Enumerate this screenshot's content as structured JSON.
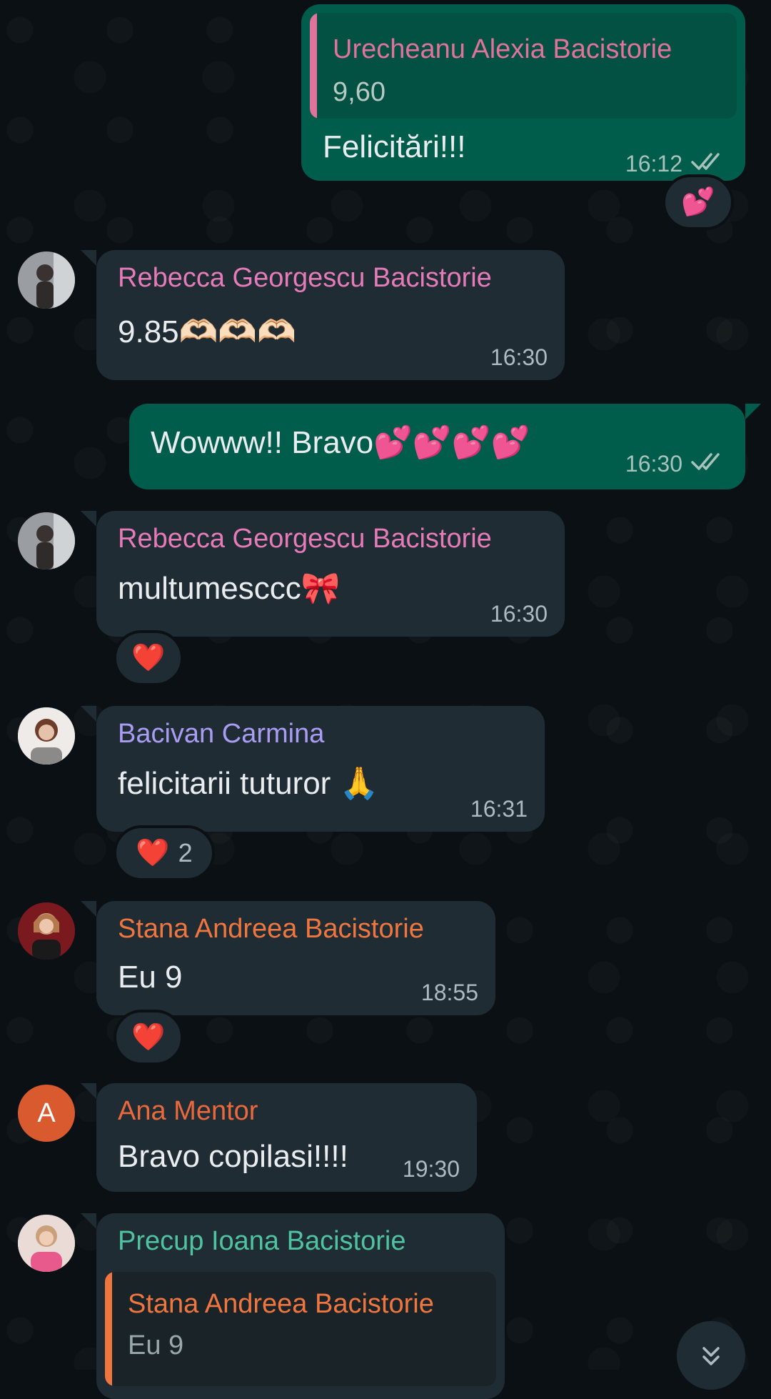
{
  "colors": {
    "background": "#0b1014",
    "incoming_bubble": "#202c33",
    "outgoing_bubble": "#005c4b",
    "timestamp": "#aebac1",
    "read_ticks": "#aebac1"
  },
  "messages": [
    {
      "direction": "out",
      "quote": {
        "sender": "Urecheanu Alexia Bacistorie",
        "sender_color": "#e0739a",
        "text": "9,60"
      },
      "text": "Felicitări!!!",
      "time": "16:12",
      "status_icon": "double-check-icon",
      "reaction": {
        "emoji": "💕",
        "count": ""
      }
    },
    {
      "direction": "in",
      "sender": "Rebecca Georgescu Bacistorie",
      "sender_color": "#e57bb8",
      "avatar": "photo",
      "text": "9.85🫶🏻🫶🏻🫶🏻",
      "time": "16:30"
    },
    {
      "direction": "out",
      "text": "Wowww!! Bravo💕💕💕💕",
      "time": "16:30",
      "status_icon": "double-check-icon"
    },
    {
      "direction": "in",
      "sender": "Rebecca Georgescu Bacistorie",
      "sender_color": "#e57bb8",
      "avatar": "photo",
      "text": "multumesccc🎀",
      "time": "16:30",
      "reaction": {
        "emoji": "❤️",
        "count": ""
      }
    },
    {
      "direction": "in",
      "sender": "Bacivan Carmina",
      "sender_color": "#a99cf3",
      "avatar": "photo",
      "text": "felicitarii tuturor 🙏",
      "time": "16:31",
      "reaction": {
        "emoji": "❤️",
        "count": "2"
      }
    },
    {
      "direction": "in",
      "sender": "Stana Andreea Bacistorie",
      "sender_color": "#f0763f",
      "avatar": "photo",
      "text": "Eu 9",
      "time": "18:55",
      "reaction": {
        "emoji": "❤️",
        "count": ""
      }
    },
    {
      "direction": "in",
      "sender": "Ana Mentor",
      "sender_color": "#e9693d",
      "avatar": "letter",
      "avatar_letter": "A",
      "avatar_color": "#d95a2e",
      "text": "Bravo copilasi!!!!",
      "time": "19:30"
    },
    {
      "direction": "in",
      "sender": "Precup Ioana Bacistorie",
      "sender_color": "#4fc3a1",
      "avatar": "photo",
      "quote": {
        "sender": "Stana Andreea Bacistorie",
        "sender_color": "#f0763f",
        "text": "Eu 9"
      }
    }
  ],
  "scroll_button": {
    "icon": "double-chevron-down-icon"
  }
}
